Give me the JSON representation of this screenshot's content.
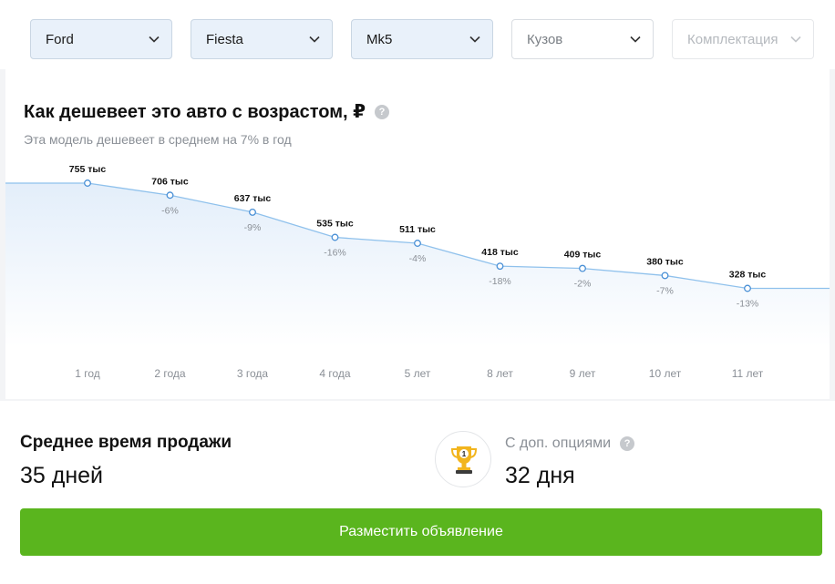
{
  "filters": [
    {
      "label": "Ford",
      "state": "selected"
    },
    {
      "label": "Fiesta",
      "state": "selected"
    },
    {
      "label": "Mk5",
      "state": "selected"
    },
    {
      "label": "Кузов",
      "state": "empty"
    },
    {
      "label": "Комплектация",
      "state": "disabled"
    }
  ],
  "chart_data": {
    "type": "line",
    "title": "Как дешевеет это авто с возрастом, ₽",
    "subtitle": "Эта модель дешевеет в среднем на 7% в год",
    "categories": [
      "1 год",
      "2 года",
      "3 года",
      "4 года",
      "5 лет",
      "8 лет",
      "9 лет",
      "10 лет",
      "11 лет"
    ],
    "values": [
      755,
      706,
      637,
      535,
      511,
      418,
      409,
      380,
      328
    ],
    "value_labels": [
      "755 тыс",
      "706 тыс",
      "637 тыс",
      "535 тыс",
      "511 тыс",
      "418 тыс",
      "409 тыс",
      "380 тыс",
      "328 тыс"
    ],
    "change_labels": [
      "",
      "-6%",
      "-9%",
      "-16%",
      "-4%",
      "-18%",
      "-2%",
      "-7%",
      "-13%"
    ],
    "unit": "тыс",
    "colors": {
      "line": "#8fc1ec",
      "fill_top": "#e3eefa",
      "fill_bottom": "#ffffff",
      "point": "#4a90d6"
    }
  },
  "stats": {
    "avg_label": "Среднее время продажи",
    "avg_value": "35 дней",
    "options_label": "С доп. опциями",
    "options_value": "32 дня",
    "trophy_number": "1"
  },
  "cta": {
    "label": "Разместить объявление",
    "color": "#5ab51e"
  },
  "help_glyph": "?"
}
